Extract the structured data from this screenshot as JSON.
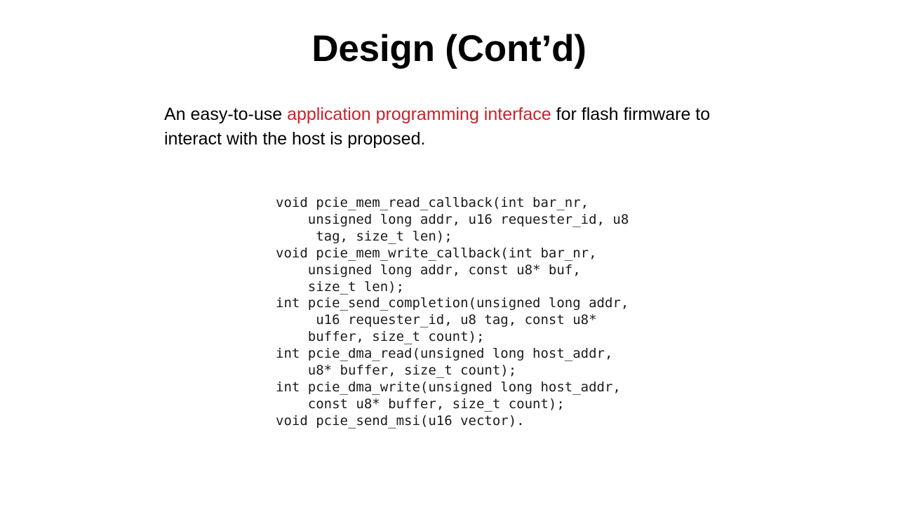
{
  "slide": {
    "title": "Design (Cont’d)",
    "background_color": "#ffffff",
    "text_color": "#000000",
    "accent_color": "#cc2229"
  },
  "body": {
    "segment_1": "An easy-to-use ",
    "highlight": "application programming interface",
    "segment_2": " for flash firmware to interact with the host is proposed."
  },
  "code": {
    "lines": [
      "void pcie_mem_read_callback(int bar_nr,",
      "    unsigned long addr, u16 requester_id, u8",
      "     tag, size_t len);",
      "void pcie_mem_write_callback(int bar_nr,",
      "    unsigned long addr, const u8* buf,",
      "    size_t len);",
      "int pcie_send_completion(unsigned long addr,",
      "     u16 requester_id, u8 tag, const u8*",
      "    buffer, size_t count);",
      "int pcie_dma_read(unsigned long host_addr,",
      "    u8* buffer, size_t count);",
      "int pcie_dma_write(unsigned long host_addr,",
      "    const u8* buffer, size_t count);",
      "void pcie_send_msi(u16 vector)."
    ]
  }
}
